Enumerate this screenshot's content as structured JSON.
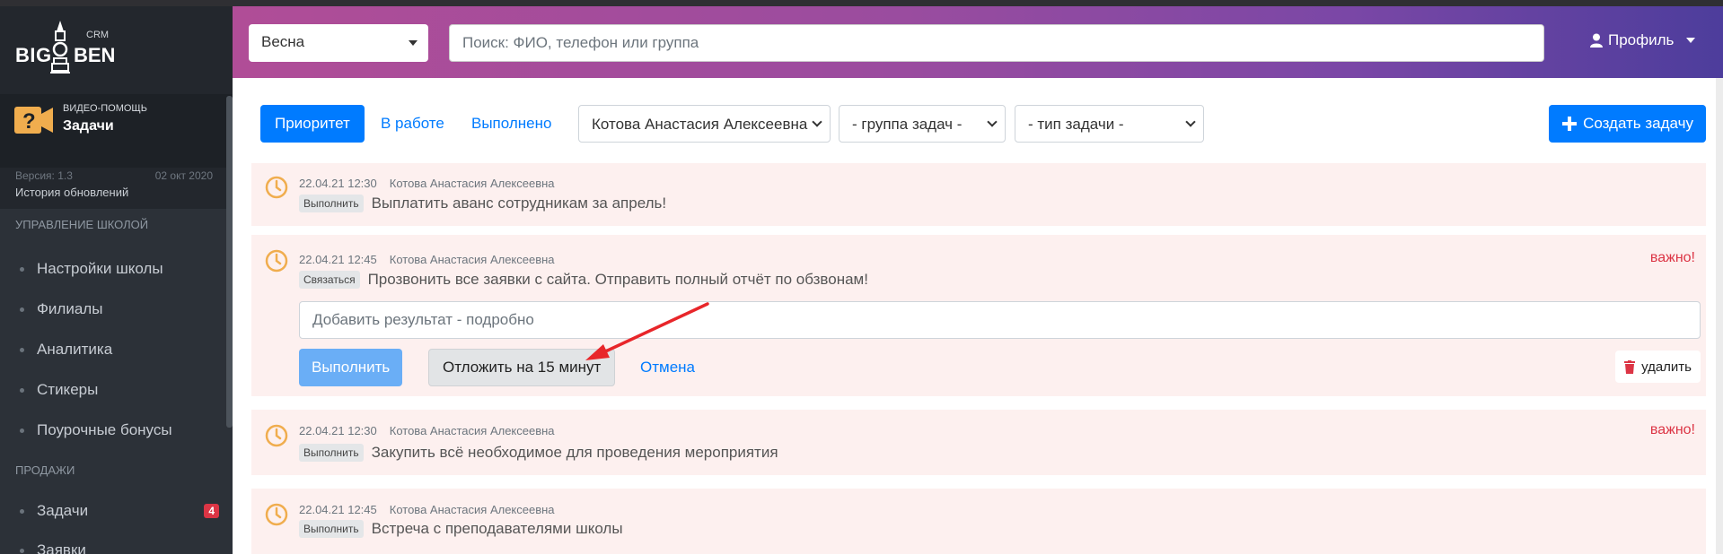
{
  "app": {
    "logo": {
      "left": "BIG",
      "right": "BEN",
      "suffix": "CRM"
    }
  },
  "sidebar": {
    "help": {
      "caption": "ВИДЕО-ПОМОЩЬ",
      "title": "Задачи"
    },
    "version": {
      "label": "Версия: 1.3",
      "date": "02 окт 2020",
      "history": "История обновлений"
    },
    "sections": [
      {
        "title": "УПРАВЛЕНИЕ ШКОЛОЙ",
        "items": [
          {
            "label": "Настройки школы"
          },
          {
            "label": "Филиалы"
          },
          {
            "label": "Аналитика"
          },
          {
            "label": "Стикеры"
          },
          {
            "label": "Поурочные бонусы"
          }
        ]
      },
      {
        "title": "ПРОДАЖИ",
        "items": [
          {
            "label": "Задачи",
            "badge": "4"
          },
          {
            "label": "Заявки"
          }
        ]
      }
    ]
  },
  "header": {
    "season": "Весна",
    "search_placeholder": "Поиск: ФИО, телефон или группа",
    "profile": "Профиль"
  },
  "toolbar": {
    "tabs": [
      {
        "label": "Приоритет",
        "active": true
      },
      {
        "label": "В работе"
      },
      {
        "label": "Выполнено"
      }
    ],
    "assignee": "Котова Анастасия Алексеевна",
    "group": "- группа задач -",
    "type": "- тип задачи -",
    "create": "Создать задачу"
  },
  "tasks": [
    {
      "date": "22.04.21 12:30",
      "author": "Котова Анастасия Алексеевна",
      "badge": "Выполнить",
      "text": "Выплатить аванс сотрудникам за апрель!",
      "important": ""
    },
    {
      "date": "22.04.21 12:45",
      "author": "Котова Анастасия Алексеевна",
      "badge": "Связаться",
      "text": "Прозвонить все заявки с сайта. Отправить полный отчёт по обзвонам!",
      "important": "важно!",
      "expanded": {
        "result_placeholder": "Добавить результат - подробно",
        "done": "Выполнить",
        "postpone": "Отложить на 15 минут",
        "cancel": "Отмена",
        "delete": "удалить"
      }
    },
    {
      "date": "22.04.21 12:30",
      "author": "Котова Анастасия Алексеевна",
      "badge": "Выполнить",
      "text": "Закупить всё необходимое для проведения мероприятия",
      "important": "важно!"
    },
    {
      "date": "22.04.21 12:45",
      "author": "Котова Анастасия Алексеевна",
      "badge": "Выполнить",
      "text": "Встреча с преподавателями школы",
      "important": ""
    }
  ],
  "colors": {
    "primary": "#007bff",
    "danger": "#dc3545",
    "sidebar": "#2c3138",
    "task_bg": "#fdf0ef",
    "clock": "#f0ad4e",
    "annotation_arrow": "#e8262a"
  }
}
